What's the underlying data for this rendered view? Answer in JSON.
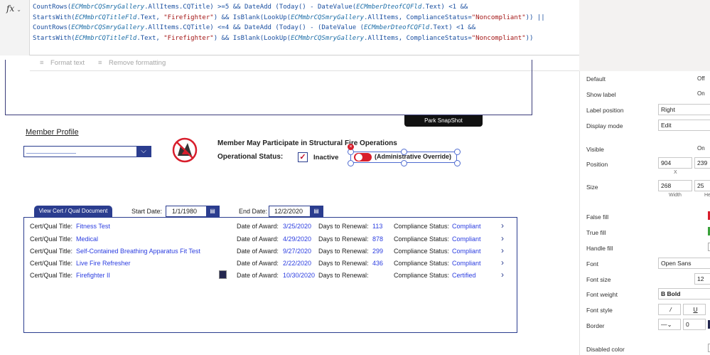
{
  "formula": {
    "fx_label": "fx",
    "segments": [
      {
        "t": "CountRows(",
        "c": "f"
      },
      {
        "t": "ECMmbrCQSmryGallery",
        "c": "i"
      },
      {
        "t": ".AllItems.CQTitle) >=5 && DateAdd (Today() - DateValue(",
        "c": "f"
      },
      {
        "t": "ECMmberDteofCQFld",
        "c": "i"
      },
      {
        "t": ".Text) <1 && StartsWith(",
        "c": "f"
      },
      {
        "t": "ECMmbrCQTitleFld",
        "c": "i"
      },
      {
        "t": ".Text, ",
        "c": "f"
      },
      {
        "t": "\"Firefighter\"",
        "c": "s"
      },
      {
        "t": ") && IsBlank(LookUp(",
        "c": "f"
      },
      {
        "t": "ECMmbrCQSmryGallery",
        "c": "i"
      },
      {
        "t": ".AllItems, ComplianceStatus=",
        "c": "f"
      },
      {
        "t": "\"Noncompliant\"",
        "c": "s"
      },
      {
        "t": ")) || CountRows(",
        "c": "f"
      },
      {
        "t": "ECMmbrCQSmryGallery",
        "c": "i"
      },
      {
        "t": ".AllItems.CQTitle) <=4 && DateAdd (Today() - (DateValue (",
        "c": "f"
      },
      {
        "t": "ECMmberDteofCQFld",
        "c": "i"
      },
      {
        "t": ".Text) <1 && StartsWith(",
        "c": "f"
      },
      {
        "t": "ECMmbrCQTitleFld",
        "c": "i"
      },
      {
        "t": ".Text, ",
        "c": "f"
      },
      {
        "t": "\"Firefighter\"",
        "c": "s"
      },
      {
        "t": ") && IsBlank(LookUp(",
        "c": "f"
      },
      {
        "t": "ECMmbrCQSmryGallery",
        "c": "i"
      },
      {
        "t": ".AllItems, ComplianceStatus=",
        "c": "f"
      },
      {
        "t": "\"Noncompliant\"",
        "c": "s"
      },
      {
        "t": "))",
        "c": "f"
      }
    ]
  },
  "toolbar": {
    "format_text": "Format text",
    "remove_formatting": "Remove formatting"
  },
  "canvas": {
    "park_snapshot": "Park SnapShot",
    "member_profile": "Member Profile",
    "structural_text": "Member May Participate in Structural Fire Operations",
    "operational_status": "Operational Status:",
    "inactive": "Inactive",
    "admin_override": "(Administrative Override)",
    "view_cert": "View Cert / Qual Document",
    "start_label": "Start Date:",
    "start_value": "1/1/1980",
    "end_label": "End Date:",
    "end_value": "12/2/2020"
  },
  "gallery": {
    "title_label": "Cert/Qual Title:",
    "award_label": "Date of Award:",
    "renewal_label": "Days to Renewal:",
    "compliance_label": "Compliance Status:",
    "rows": [
      {
        "title": "Fitness Test",
        "award": "3/25/2020",
        "renewal": "113",
        "status": "Compliant"
      },
      {
        "title": "Medical",
        "award": "4/29/2020",
        "renewal": "878",
        "status": "Compliant"
      },
      {
        "title": "Self-Contained Breathing Apparatus Fit Test",
        "award": "9/27/2020",
        "renewal": "299",
        "status": "Compliant"
      },
      {
        "title": "Live Fire Refresher",
        "award": "2/22/2020",
        "renewal": "436",
        "status": "Compliant"
      },
      {
        "title": "Firefighter II",
        "award": "10/30/2020",
        "renewal": "",
        "status": "Certified"
      }
    ]
  },
  "props": {
    "default_label": "Default",
    "default_value": "Off",
    "show_label": "Show label",
    "show_value": "On",
    "label_position": "Label position",
    "label_position_value": "Right",
    "display_mode": "Display mode",
    "display_mode_value": "Edit",
    "visible": "Visible",
    "visible_value": "On",
    "position": "Position",
    "pos_x": "904",
    "pos_y": "239",
    "x_label": "X",
    "size": "Size",
    "width": "268",
    "height": "25",
    "width_label": "Width",
    "height_label": "He",
    "false_fill": "False fill",
    "true_fill": "True fill",
    "handle_fill": "Handle fill",
    "font": "Font",
    "font_value": "Open Sans",
    "font_size": "Font size",
    "font_size_value": "12",
    "font_weight": "Font weight",
    "font_weight_value": "Bold",
    "font_style": "Font style",
    "italic": "/",
    "underline": "U",
    "border": "Border",
    "border_value": "0",
    "disabled_color": "Disabled color"
  },
  "colors": {
    "accent": "#2b3d8f",
    "danger": "#d81e2c",
    "link": "#2b3de0"
  }
}
